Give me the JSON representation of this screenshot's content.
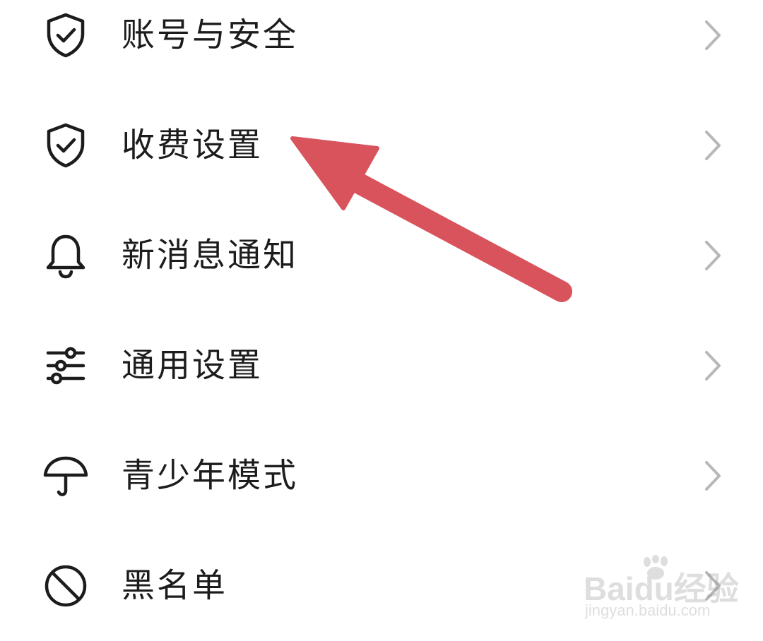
{
  "menu": {
    "items": [
      {
        "label": "账号与安全",
        "icon": "shield-check-icon"
      },
      {
        "label": "收费设置",
        "icon": "shield-check-icon"
      },
      {
        "label": "新消息通知",
        "icon": "bell-icon"
      },
      {
        "label": "通用设置",
        "icon": "sliders-icon"
      },
      {
        "label": "青少年模式",
        "icon": "umbrella-icon"
      },
      {
        "label": "黑名单",
        "icon": "block-icon"
      }
    ]
  },
  "annotation": {
    "arrow_color": "#d9535c",
    "target": "收费设置"
  },
  "watermark": {
    "brand": "Baidu经验",
    "url": "jingyan.baidu.com"
  },
  "colors": {
    "text": "#1c1c1c",
    "icon": "#1c1c1c",
    "chevron": "#b8b8b8",
    "background": "#ffffff"
  }
}
